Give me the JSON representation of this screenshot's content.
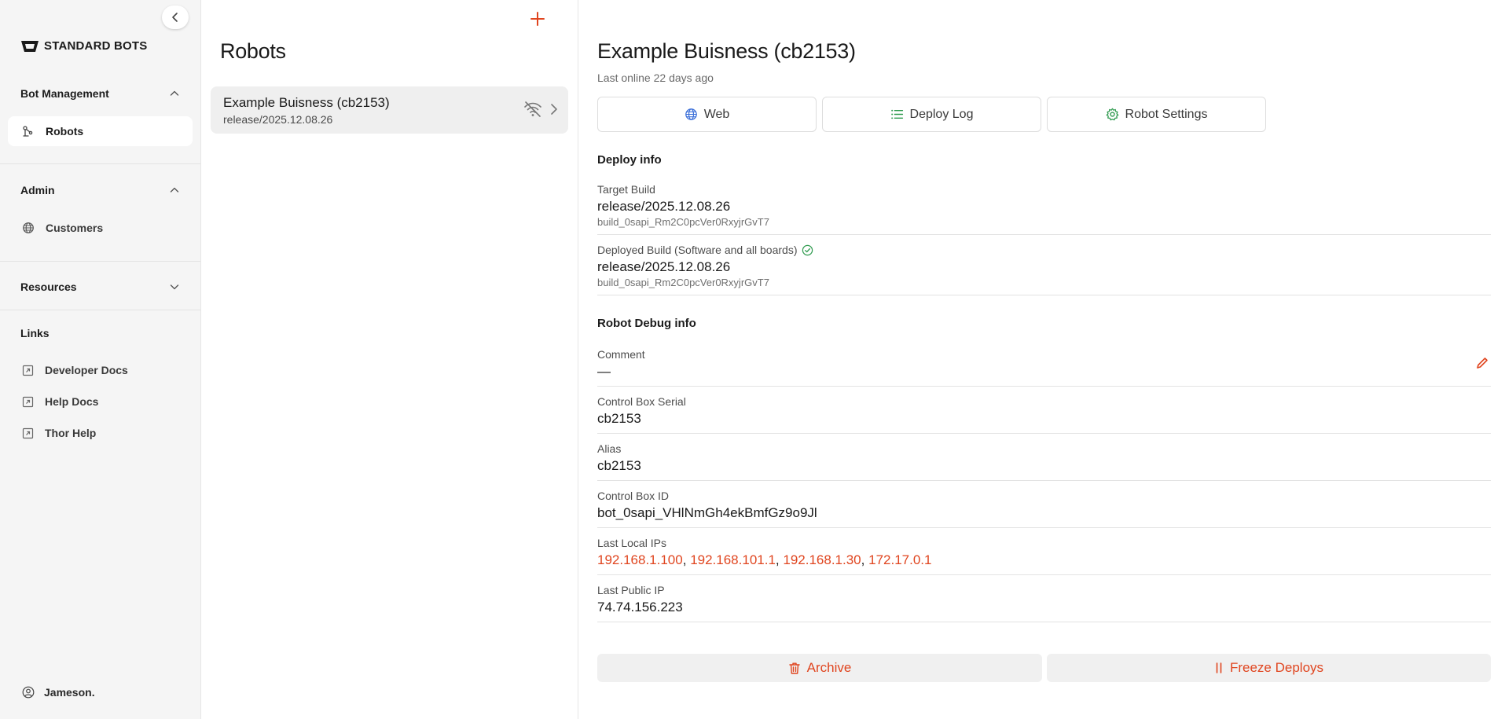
{
  "colors": {
    "accent": "#e0451f",
    "success": "#2e9a4e",
    "link_blue": "#3b6fd9",
    "sidebar_bg": "#f5f5f5"
  },
  "sidebar": {
    "brand": "STANDARD BOTS",
    "sections": [
      {
        "title": "Bot Management",
        "expanded": true,
        "items": [
          {
            "label": "Robots",
            "icon": "robot-arm-icon",
            "active": true
          }
        ]
      },
      {
        "title": "Admin",
        "expanded": true,
        "items": [
          {
            "label": "Customers",
            "icon": "globe-icon",
            "active": false
          }
        ]
      },
      {
        "title": "Resources",
        "expanded": false,
        "items": []
      }
    ],
    "links_title": "Links",
    "links": [
      {
        "label": "Developer Docs",
        "icon": "external-link-icon"
      },
      {
        "label": "Help Docs",
        "icon": "external-link-icon"
      },
      {
        "label": "Thor Help",
        "icon": "external-link-icon"
      }
    ],
    "user": "Jameson."
  },
  "robots_list": {
    "title": "Robots",
    "items": [
      {
        "name": "Example Buisness (cb2153)",
        "build": "release/2025.12.08.26",
        "status_icon": "wifi-off-icon"
      }
    ]
  },
  "detail": {
    "title": "Example Buisness (cb2153)",
    "subtitle": "Last online 22 days ago",
    "tabs": [
      {
        "label": "Web",
        "icon": "globe-icon"
      },
      {
        "label": "Deploy Log",
        "icon": "list-icon"
      },
      {
        "label": "Robot Settings",
        "icon": "gear-icon"
      }
    ],
    "deploy_info": {
      "title": "Deploy info",
      "target_build": {
        "label": "Target Build",
        "value": "release/2025.12.08.26",
        "sub": "build_0sapi_Rm2C0pcVer0RxyjrGvT7"
      },
      "deployed_build": {
        "label": "Deployed Build (Software and all boards)",
        "value": "release/2025.12.08.26",
        "sub": "build_0sapi_Rm2C0pcVer0RxyjrGvT7",
        "status_icon": "check-circle-icon"
      }
    },
    "debug_info": {
      "title": "Robot Debug info",
      "comment": {
        "label": "Comment",
        "value": "—"
      },
      "control_box_serial": {
        "label": "Control Box Serial",
        "value": "cb2153"
      },
      "alias": {
        "label": "Alias",
        "value": "cb2153"
      },
      "control_box_id": {
        "label": "Control Box ID",
        "value": "bot_0sapi_VHlNmGh4ekBmfGz9o9Jl"
      },
      "last_local_ips": {
        "label": "Last Local IPs",
        "values": [
          "192.168.1.100",
          "192.168.101.1",
          "192.168.1.30",
          "172.17.0.1"
        ],
        "separator": ","
      },
      "last_public_ip": {
        "label": "Last Public IP",
        "value": "74.74.156.223"
      }
    },
    "actions": {
      "archive": "Archive",
      "freeze": "Freeze Deploys"
    }
  }
}
